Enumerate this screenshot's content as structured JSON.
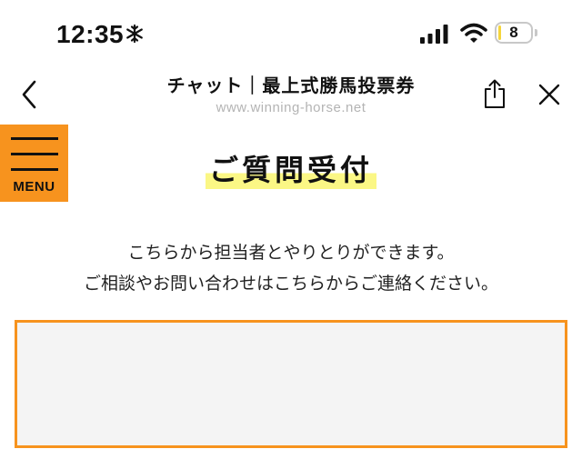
{
  "status_bar": {
    "time": "12:35",
    "battery_level": "8",
    "battery_fraction": 0.08,
    "icons": [
      "snowflake-icon",
      "cellular-signal-icon",
      "wifi-icon",
      "battery-icon"
    ]
  },
  "nav": {
    "title": "チャット｜最上式勝馬投票券",
    "url": "www.winning-horse.net",
    "icons": [
      "chevron-left-icon",
      "share-icon",
      "close-icon"
    ]
  },
  "menu": {
    "label": "MENU",
    "icon": "hamburger-icon",
    "color": "#f7931e"
  },
  "main": {
    "title": "ご質問受付",
    "intro_line1": "こちらから担当者とやりとりができます。",
    "intro_line2": "ご相談やお問い合わせはこちらからご連絡ください。"
  },
  "colors": {
    "accent": "#f7931e",
    "highlight": "#fbf785",
    "box_background": "#f4f4f4"
  }
}
